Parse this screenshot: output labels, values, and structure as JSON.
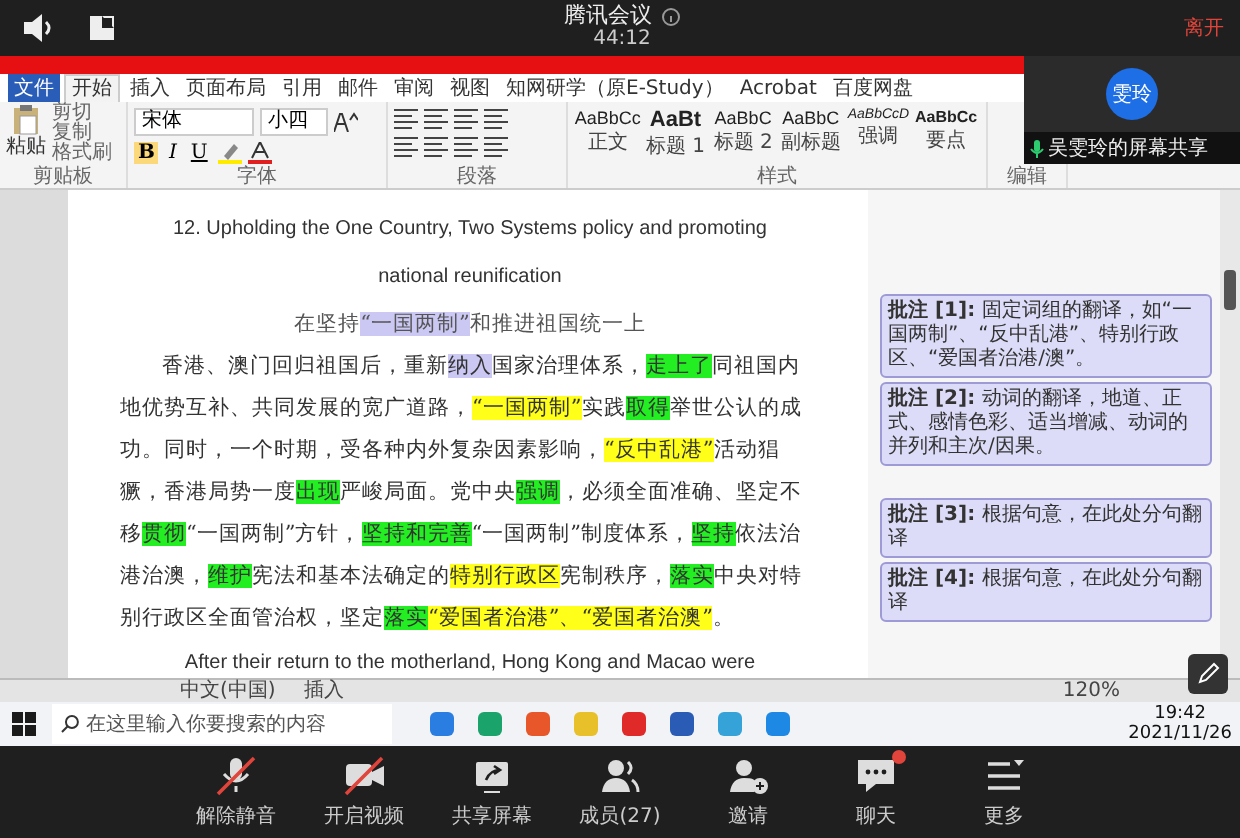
{
  "meeting": {
    "title": "腾讯会议",
    "elapsed": "44:12",
    "leave": "离开"
  },
  "video_tile": {
    "avatar": "雯玲",
    "caption": "吴雯玲的屏幕共享"
  },
  "word": {
    "tabs": [
      {
        "label": "文件",
        "kind": "file",
        "selected": false
      },
      {
        "label": "开始",
        "kind": "tab",
        "selected": true
      },
      {
        "label": "插入",
        "kind": "tab",
        "selected": false
      },
      {
        "label": "页面布局",
        "kind": "tab",
        "selected": false
      },
      {
        "label": "引用",
        "kind": "tab",
        "selected": false
      },
      {
        "label": "邮件",
        "kind": "tab",
        "selected": false
      },
      {
        "label": "审阅",
        "kind": "tab",
        "selected": false
      },
      {
        "label": "视图",
        "kind": "tab",
        "selected": false
      },
      {
        "label": "知网研学（原E-Study）",
        "kind": "tab",
        "selected": false
      },
      {
        "label": "Acrobat",
        "kind": "tab",
        "selected": false
      },
      {
        "label": "百度网盘",
        "kind": "tab",
        "selected": false
      }
    ],
    "clipboard": {
      "paste": "粘贴",
      "items": [
        "剪切",
        "复制",
        "格式刷"
      ]
    },
    "font": {
      "name": "宋体",
      "size": "小四",
      "buttons": [
        "B",
        "I",
        "U"
      ]
    },
    "styles": [
      {
        "sample": "AaBbCc",
        "label": "正文",
        "kind": "normal"
      },
      {
        "sample": "AaBt",
        "label": "标题 1",
        "kind": "heading"
      },
      {
        "sample": "AaBbC",
        "label": "标题 2",
        "kind": "normal"
      },
      {
        "sample": "AaBbC",
        "label": "副标题",
        "kind": "normal"
      },
      {
        "sample": "AaBbCcD",
        "label": "强调",
        "kind": "emphasis"
      },
      {
        "sample": "AaBbCc",
        "label": "要点",
        "kind": "strong"
      }
    ],
    "groups": [
      "剪贴板",
      "字体",
      "段落",
      "样式",
      "编辑"
    ],
    "document": {
      "heading": "12. Upholding the One Country, Two Systems policy and promoting national reunification",
      "subtitle": [
        {
          "text": "在坚持"
        },
        {
          "text": "“一国两制”",
          "color": "#cbc8f4"
        },
        {
          "text": "和推进祖国统一上"
        }
      ],
      "paragraph": [
        {
          "text": "香港、澳门回归祖国后，重新"
        },
        {
          "text": "纳入",
          "color": "#cbc8f4"
        },
        {
          "text": "国家治理体系，"
        },
        {
          "text": "走上了",
          "color": "#22ee22"
        },
        {
          "text": "同祖国内地优势互补、共同发展的宽广道路，"
        },
        {
          "text": "“一国两制”",
          "color": "#ffff1a"
        },
        {
          "text": "实践"
        },
        {
          "text": "取得",
          "color": "#22ee22"
        },
        {
          "text": "举世公认的成功。同时，一个时期，受各种内外复杂因素影响，"
        },
        {
          "text": "“反中乱港”",
          "color": "#ffff1a"
        },
        {
          "text": "活动猖獗，香港局势一度"
        },
        {
          "text": "出现",
          "color": "#22ee22"
        },
        {
          "text": "严峻局面。党中央"
        },
        {
          "text": "强调",
          "color": "#22ee22"
        },
        {
          "text": "，必须全面准确、坚定不移"
        },
        {
          "text": "贯彻",
          "color": "#22ee22"
        },
        {
          "text": "“一国两制”方针，"
        },
        {
          "text": "坚持和完善",
          "color": "#22ee22"
        },
        {
          "text": "“一国两制”制度体系，"
        },
        {
          "text": "坚持",
          "color": "#22ee22"
        },
        {
          "text": "依法治港治澳，"
        },
        {
          "text": "维护",
          "color": "#22ee22"
        },
        {
          "text": "宪法和基本法确定的"
        },
        {
          "text": "特别行政区",
          "color": "#ffff1a"
        },
        {
          "text": "宪制秩序，"
        },
        {
          "text": "落实",
          "color": "#22ee22"
        },
        {
          "text": "中央对特别行政区全面管治权，坚定"
        },
        {
          "text": "落实",
          "color": "#22ee22"
        },
        {
          "text": "“爱国者治港”、“爱国者治澳”",
          "color": "#ffff1a"
        },
        {
          "text": "。"
        }
      ],
      "english": "After their return to the motherland, Hong Kong and Macao were"
    },
    "comments": [
      {
        "label": "批注 [1]:",
        "text": "固定词组的翻译，如“一国两制”、“反中乱港”、特别行政区、“爱国者治港/澳”。"
      },
      {
        "label": "批注 [2]:",
        "text": "动词的翻译，地道、正式、感情色彩、适当增减、动词的并列和主次/因果。"
      },
      {
        "label": "批注 [3]:",
        "text": "根据句意，在此处分句翻译"
      },
      {
        "label": "批注 [4]:",
        "text": "根据句意，在此处分句翻译"
      }
    ],
    "status_bar": {
      "language": "中文(中国)",
      "mode": "插入",
      "zoom": "120%"
    }
  },
  "taskbar": {
    "search_placeholder": "在这里输入你要搜索的内容",
    "time": "19:42",
    "date": "2021/11/26"
  },
  "toolbar": [
    {
      "label": "解除静音",
      "kind": "mic",
      "off": true,
      "badge": false
    },
    {
      "label": "开启视频",
      "kind": "camera",
      "off": true,
      "badge": false
    },
    {
      "label": "共享屏幕",
      "kind": "share",
      "off": false,
      "badge": false
    },
    {
      "label": "成员(27)",
      "kind": "members",
      "off": false,
      "badge": false
    },
    {
      "label": "邀请",
      "kind": "invite",
      "off": false,
      "badge": false
    },
    {
      "label": "聊天",
      "kind": "chat",
      "off": false,
      "badge": true
    },
    {
      "label": "更多",
      "kind": "more",
      "off": false,
      "badge": false
    }
  ]
}
